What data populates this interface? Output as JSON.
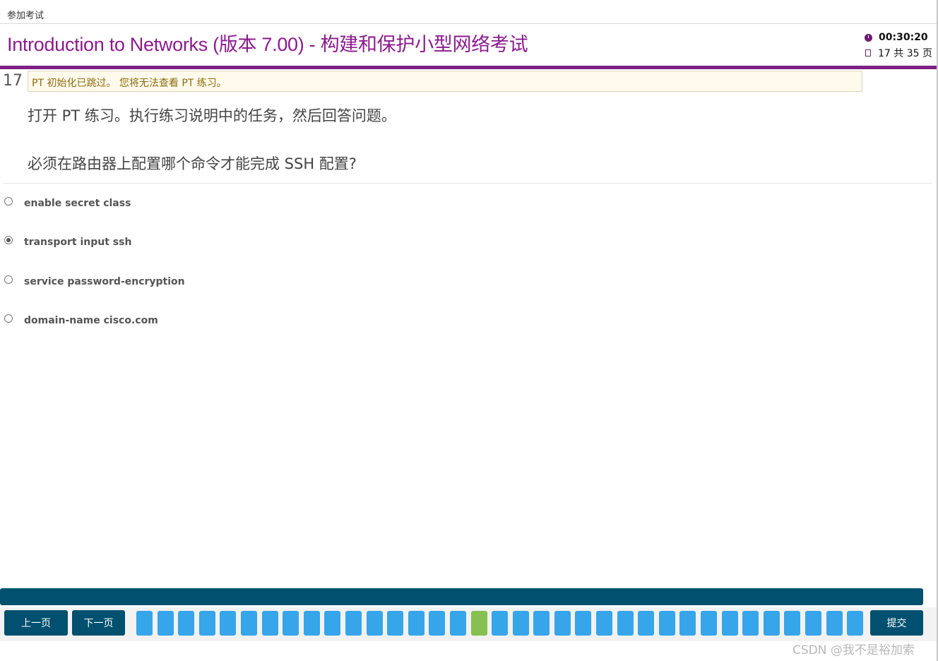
{
  "window": {
    "title": "参加考试"
  },
  "header": {
    "exam_title": "Introduction to Networks (版本 7.00) - 构建和保护小型网络考试",
    "timer": "00:30:20",
    "page_status": "17 共 35 页"
  },
  "question": {
    "number": "17",
    "notice": "PT 初始化已跳过。 您将无法查看 PT 练习。",
    "instruction": "打开 PT 练习。执行练习说明中的任务，然后回答问题。",
    "prompt": "必须在路由器上配置哪个命令才能完成 SSH 配置?",
    "options": [
      {
        "label": "enable secret class",
        "selected": false
      },
      {
        "label": "transport input ssh",
        "selected": true
      },
      {
        "label": "service password-encryption",
        "selected": false
      },
      {
        "label": "domain-name cisco.com",
        "selected": false
      }
    ]
  },
  "footer": {
    "prev_label": "上一页",
    "next_label": "下一页",
    "submit_label": "提交",
    "total_pages": 35,
    "current_page": 17,
    "page_color": "#36a5ea",
    "current_page_color": "#87bf52"
  },
  "watermark": "CSDN @我不是裕加索",
  "colors": {
    "brand_purple": "#7d1f86",
    "nav_blue": "#02506f"
  }
}
